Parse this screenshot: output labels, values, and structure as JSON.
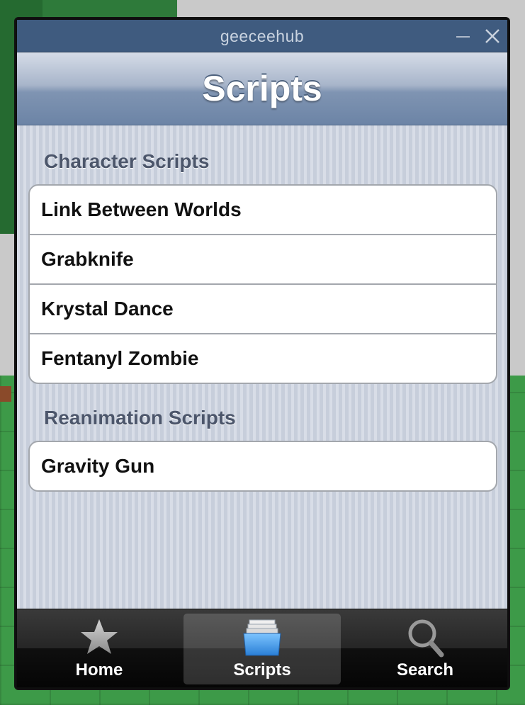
{
  "window": {
    "title": "geeceehub"
  },
  "nav": {
    "title": "Scripts"
  },
  "sections": [
    {
      "header": "Character Scripts",
      "items": [
        "Link Between Worlds",
        "Grabknife",
        "Krystal Dance",
        "Fentanyl Zombie"
      ]
    },
    {
      "header": "Reanimation Scripts",
      "items": [
        "Gravity Gun"
      ]
    }
  ],
  "tabs": [
    {
      "label": "Home",
      "icon": "star-icon",
      "active": false
    },
    {
      "label": "Scripts",
      "icon": "folder-icon",
      "active": true
    },
    {
      "label": "Search",
      "icon": "search-icon",
      "active": false
    }
  ],
  "colors": {
    "titlebar": "#3f5b7f",
    "section_text": "#4c566b",
    "scripts_icon": "#3b8fe0"
  }
}
